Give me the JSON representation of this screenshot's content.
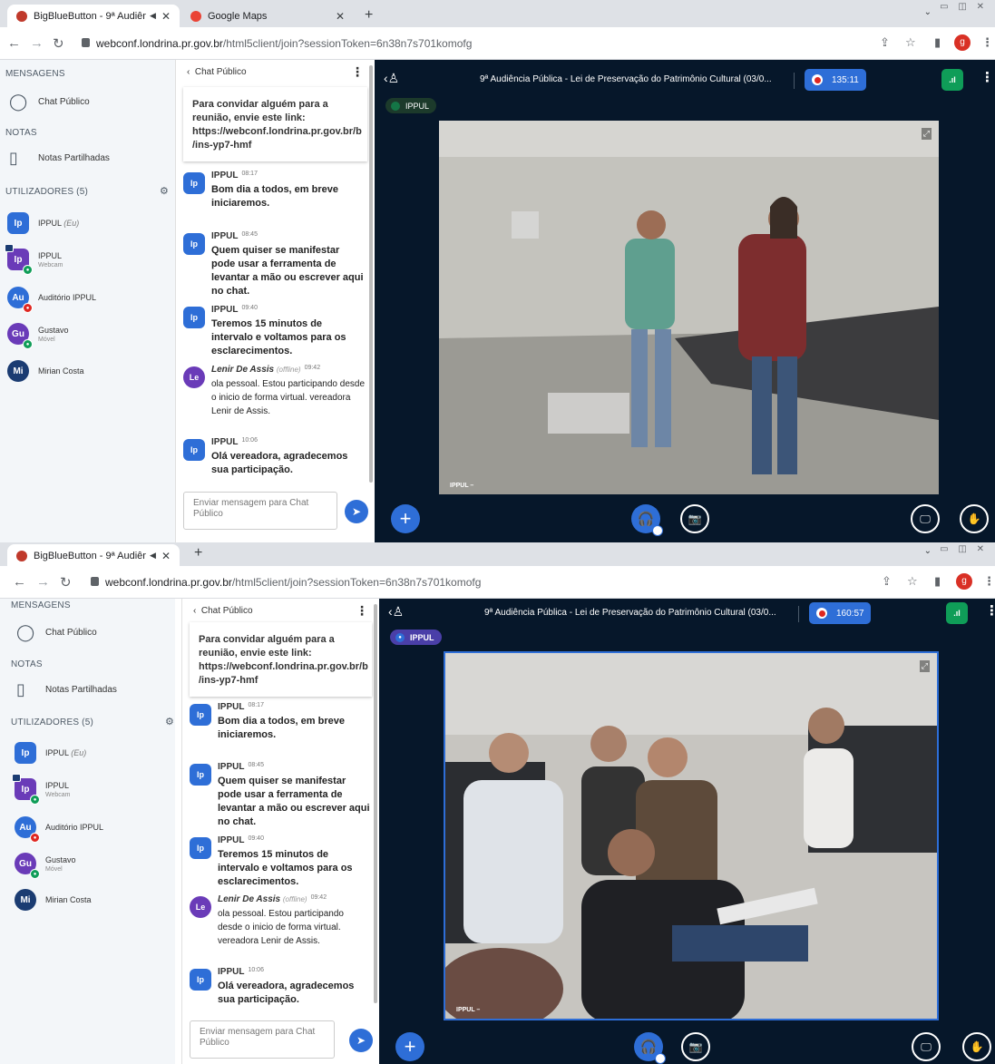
{
  "browser": {
    "tab_title": "BigBlueButton - 9ª Audiênci",
    "tab2_title": "Google Maps",
    "url_host": "webconf.londrina.pr.gov.br",
    "url_path": "/html5client/join?sessionToken=6n38n7s701komofg",
    "profile_initial": "g"
  },
  "sidebar": {
    "messages_header": "MENSAGENS",
    "chat_item": "Chat Público",
    "notes_header": "NOTAS",
    "notes_item": "Notas Partilhadas",
    "users_header": "UTILIZADORES (5)",
    "users": [
      {
        "initials": "Ip",
        "name": "IPPUL",
        "suffix": "(Eu)",
        "sub": "",
        "color": "#2e6ed7",
        "shape": "square"
      },
      {
        "initials": "Ip",
        "name": "IPPUL",
        "suffix": "",
        "sub": "Webcam",
        "color": "#6a3bb8",
        "shape": "square"
      },
      {
        "initials": "Au",
        "name": "Auditório IPPUL",
        "suffix": "",
        "sub": "",
        "color": "#2e6ed7",
        "shape": "round"
      },
      {
        "initials": "Gu",
        "name": "Gustavo",
        "suffix": "",
        "sub": "Móvel",
        "color": "#6a3bb8",
        "shape": "round"
      },
      {
        "initials": "Mi",
        "name": "Mirian Costa",
        "suffix": "",
        "sub": "",
        "color": "#1b3c72",
        "shape": "round"
      }
    ]
  },
  "chat": {
    "header": "Chat Público",
    "welcome": "Para convidar alguém para a reunião, envie este link: https://webconf.londrina.pr.gov.br/b /ins-yp7-hmf",
    "messages": [
      {
        "initials": "Ip",
        "author": "IPPUL",
        "time": "08:17",
        "text": "Bom dia a todos, em breve iniciaremos."
      },
      {
        "initials": "Ip",
        "author": "IPPUL",
        "time": "08:45",
        "text": "Quem quiser se manifestar pode usar a ferramenta de levantar a mão ou escrever aqui no chat."
      },
      {
        "initials": "Ip",
        "author": "IPPUL",
        "time": "09:40",
        "text": "Teremos 15 minutos de intervalo e voltamos para os esclarecimentos."
      },
      {
        "initials": "Le",
        "author": "Lenir De Assis",
        "offline": "(offline)",
        "time": "09:42",
        "text": "ola pessoal. Estou participando desde o inicio de forma virtual. vereadora Lenir de Assis."
      },
      {
        "initials": "Ip",
        "author": "IPPUL",
        "time": "10:06",
        "text": "Olá vereadora, agradecemos sua participação."
      }
    ],
    "input_placeholder": "Enviar mensagem para Chat Público"
  },
  "meeting": {
    "title": "9ª Audiência Pública - Lei de Preservação do Patrimônio Cultural (03/0...",
    "timer_1": "135:11",
    "timer_2": "160:57",
    "talker": "IPPUL",
    "video_label": "IPPUL –"
  },
  "colors": {
    "accent": "#2e6ed7",
    "main_bg": "#06172a",
    "record": "#df2721",
    "signal": "#0f9d58"
  }
}
